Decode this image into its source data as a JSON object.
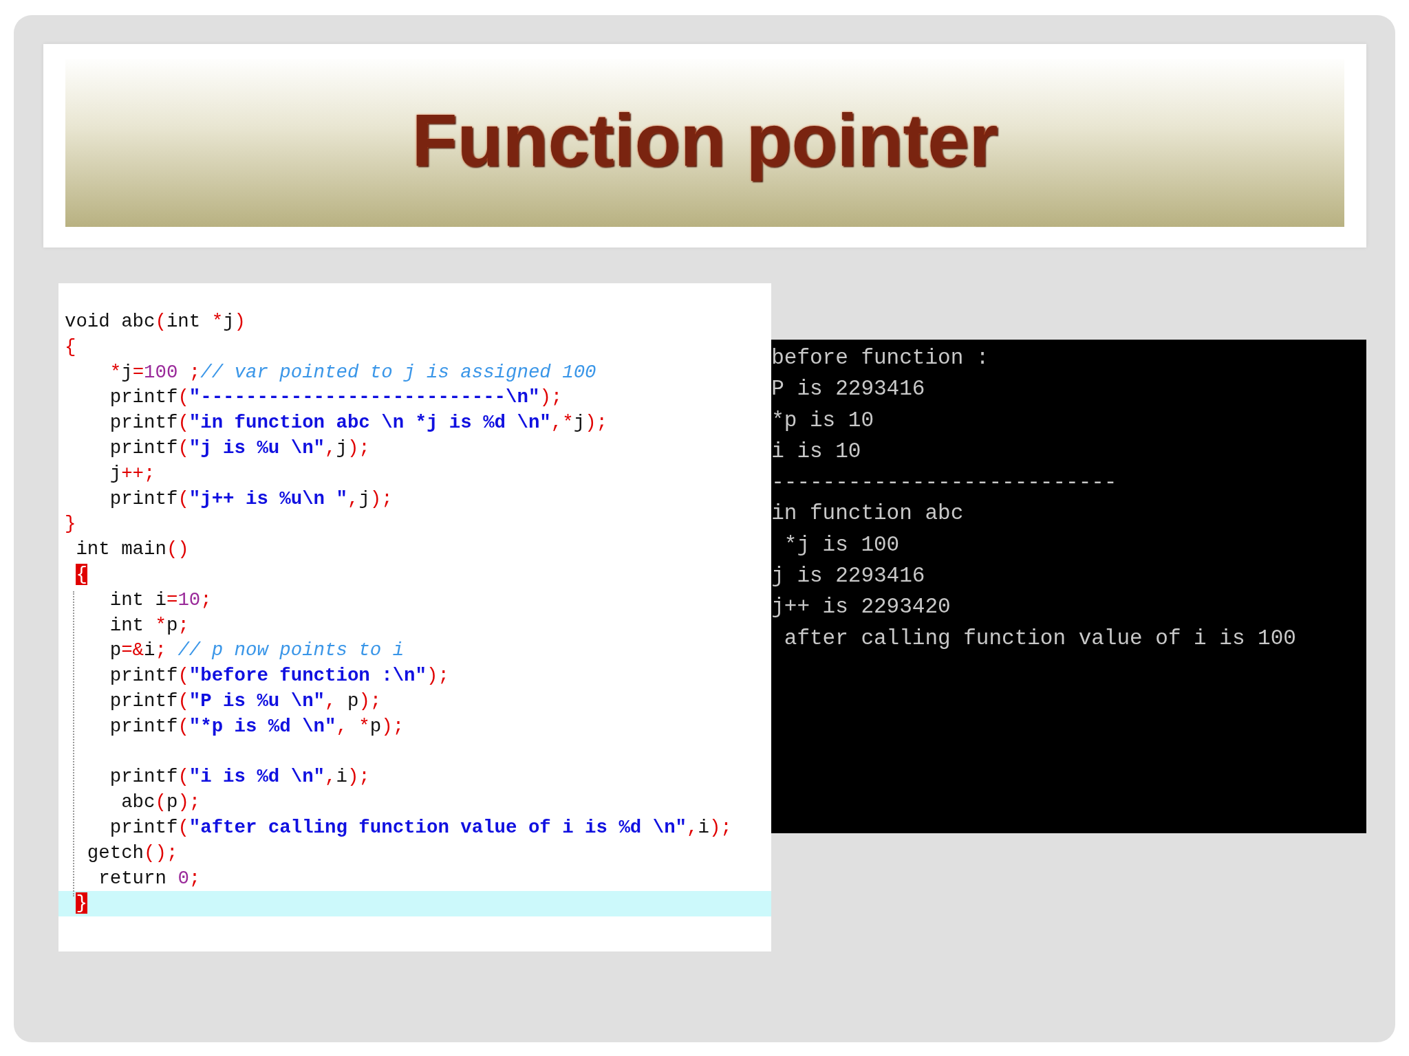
{
  "slide_title": "Function pointer",
  "code_editor": {
    "lines": [
      {
        "highlighted": false,
        "segments": [
          {
            "kind": "plain",
            "text": "void abc"
          },
          {
            "kind": "op",
            "text": "("
          },
          {
            "kind": "plain",
            "text": "int "
          },
          {
            "kind": "op",
            "text": "*"
          },
          {
            "kind": "plain",
            "text": "j"
          },
          {
            "kind": "op",
            "text": ")"
          }
        ]
      },
      {
        "highlighted": false,
        "segments": [
          {
            "kind": "op",
            "text": "{"
          }
        ]
      },
      {
        "highlighted": false,
        "segments": [
          {
            "kind": "op",
            "text": "    *"
          },
          {
            "kind": "plain",
            "text": "j"
          },
          {
            "kind": "op",
            "text": "="
          },
          {
            "kind": "num",
            "text": "100 "
          },
          {
            "kind": "op",
            "text": ";"
          },
          {
            "kind": "comment",
            "text": "// var pointed to j is assigned 100"
          }
        ]
      },
      {
        "highlighted": false,
        "segments": [
          {
            "kind": "plain",
            "text": "    printf"
          },
          {
            "kind": "op",
            "text": "("
          },
          {
            "kind": "str",
            "text": "\"---------------------------\\n\""
          },
          {
            "kind": "op",
            "text": ");"
          }
        ]
      },
      {
        "highlighted": false,
        "segments": [
          {
            "kind": "plain",
            "text": "    printf"
          },
          {
            "kind": "op",
            "text": "("
          },
          {
            "kind": "str",
            "text": "\"in function abc \\n *j is %d \\n\""
          },
          {
            "kind": "op",
            "text": ",*"
          },
          {
            "kind": "plain",
            "text": "j"
          },
          {
            "kind": "op",
            "text": ");"
          }
        ]
      },
      {
        "highlighted": false,
        "segments": [
          {
            "kind": "plain",
            "text": "    printf"
          },
          {
            "kind": "op",
            "text": "("
          },
          {
            "kind": "str",
            "text": "\"j is %u \\n\""
          },
          {
            "kind": "op",
            "text": ","
          },
          {
            "kind": "plain",
            "text": "j"
          },
          {
            "kind": "op",
            "text": ");"
          }
        ]
      },
      {
        "highlighted": false,
        "segments": [
          {
            "kind": "plain",
            "text": "    j"
          },
          {
            "kind": "op",
            "text": "++;"
          }
        ]
      },
      {
        "highlighted": false,
        "segments": [
          {
            "kind": "plain",
            "text": "    printf"
          },
          {
            "kind": "op",
            "text": "("
          },
          {
            "kind": "str",
            "text": "\"j++ is %u\\n \""
          },
          {
            "kind": "op",
            "text": ","
          },
          {
            "kind": "plain",
            "text": "j"
          },
          {
            "kind": "op",
            "text": ");"
          }
        ]
      },
      {
        "highlighted": false,
        "segments": [
          {
            "kind": "op",
            "text": "}"
          }
        ]
      },
      {
        "highlighted": false,
        "segments": [
          {
            "kind": "plain",
            "text": " int main"
          },
          {
            "kind": "op",
            "text": "()"
          }
        ]
      },
      {
        "highlighted": false,
        "segments": [
          {
            "kind": "brace-match",
            "text": " {"
          }
        ]
      },
      {
        "highlighted": false,
        "segments": [
          {
            "kind": "plain",
            "text": "    int i"
          },
          {
            "kind": "op",
            "text": "="
          },
          {
            "kind": "num",
            "text": "10"
          },
          {
            "kind": "op",
            "text": ";"
          }
        ]
      },
      {
        "highlighted": false,
        "segments": [
          {
            "kind": "plain",
            "text": "    int "
          },
          {
            "kind": "op",
            "text": "*"
          },
          {
            "kind": "plain",
            "text": "p"
          },
          {
            "kind": "op",
            "text": ";"
          }
        ]
      },
      {
        "highlighted": false,
        "segments": [
          {
            "kind": "plain",
            "text": "    p"
          },
          {
            "kind": "op",
            "text": "=&"
          },
          {
            "kind": "plain",
            "text": "i"
          },
          {
            "kind": "op",
            "text": "; "
          },
          {
            "kind": "comment",
            "text": "// p now points to i"
          }
        ]
      },
      {
        "highlighted": false,
        "segments": [
          {
            "kind": "plain",
            "text": "    printf"
          },
          {
            "kind": "op",
            "text": "("
          },
          {
            "kind": "str",
            "text": "\"before function :\\n\""
          },
          {
            "kind": "op",
            "text": ");"
          }
        ]
      },
      {
        "highlighted": false,
        "segments": [
          {
            "kind": "plain",
            "text": "    printf"
          },
          {
            "kind": "op",
            "text": "("
          },
          {
            "kind": "str",
            "text": "\"P is %u \\n\""
          },
          {
            "kind": "op",
            "text": ", "
          },
          {
            "kind": "plain",
            "text": "p"
          },
          {
            "kind": "op",
            "text": ");"
          }
        ]
      },
      {
        "highlighted": false,
        "segments": [
          {
            "kind": "plain",
            "text": "    printf"
          },
          {
            "kind": "op",
            "text": "("
          },
          {
            "kind": "str",
            "text": "\"*p is %d \\n\""
          },
          {
            "kind": "op",
            "text": ", *"
          },
          {
            "kind": "plain",
            "text": "p"
          },
          {
            "kind": "op",
            "text": ");"
          }
        ]
      },
      {
        "highlighted": false
      },
      {
        "highlighted": false,
        "segments": [
          {
            "kind": "plain",
            "text": "    printf"
          },
          {
            "kind": "op",
            "text": "("
          },
          {
            "kind": "str",
            "text": "\"i is %d \\n\""
          },
          {
            "kind": "op",
            "text": ","
          },
          {
            "kind": "plain",
            "text": "i"
          },
          {
            "kind": "op",
            "text": ");"
          }
        ]
      },
      {
        "highlighted": false,
        "segments": [
          {
            "kind": "plain",
            "text": "     abc"
          },
          {
            "kind": "op",
            "text": "("
          },
          {
            "kind": "plain",
            "text": "p"
          },
          {
            "kind": "op",
            "text": ");"
          }
        ]
      },
      {
        "highlighted": false,
        "segments": [
          {
            "kind": "plain",
            "text": "    printf"
          },
          {
            "kind": "op",
            "text": "("
          },
          {
            "kind": "str",
            "text": "\"after calling function value of i is %d \\n\""
          },
          {
            "kind": "op",
            "text": ","
          },
          {
            "kind": "plain",
            "text": "i"
          },
          {
            "kind": "op",
            "text": ");"
          }
        ]
      },
      {
        "highlighted": false,
        "segments": [
          {
            "kind": "plain",
            "text": "  getch"
          },
          {
            "kind": "op",
            "text": "();"
          }
        ]
      },
      {
        "highlighted": false,
        "segments": [
          {
            "kind": "plain",
            "text": "   return "
          },
          {
            "kind": "num",
            "text": "0"
          },
          {
            "kind": "op",
            "text": ";"
          }
        ]
      },
      {
        "highlighted": true,
        "segments": [
          {
            "kind": "brace-match",
            "text": " }"
          }
        ]
      }
    ]
  },
  "console_output": {
    "lines": [
      "before function :",
      "P is 2293416",
      "*p is 10",
      "i is 10",
      "---------------------------",
      "in function abc",
      " *j is 100",
      "j is 2293416",
      "j++ is 2293420",
      " after calling function value of i is 100"
    ]
  }
}
